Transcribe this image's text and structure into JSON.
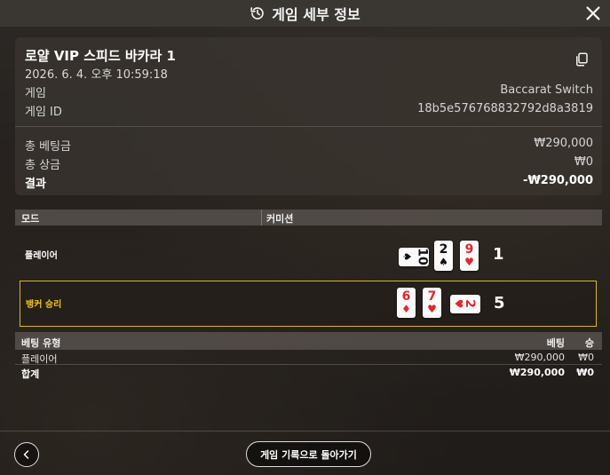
{
  "topbar": {
    "title": "게임 세부 정보",
    "history_icon": "history-icon",
    "close_icon": "close-icon"
  },
  "summary": {
    "game_name": "로얄 VIP 스피드 바카라 1",
    "datetime": "2026. 6. 4. 오후 10:59:18",
    "game_label": "게임",
    "game_value": "Baccarat Switch",
    "game_id_label": "게임 ID",
    "game_id_value": "18b5e576768832792d8a3819",
    "total_bet_label": "총 베팅금",
    "total_bet_value": "₩290,000",
    "total_win_label": "총 상금",
    "total_win_value": "₩0",
    "result_label": "결과",
    "result_value": "-₩290,000",
    "copy_icon": "copy-icon"
  },
  "mode_header": {
    "mode": "모드",
    "commission": "커미션"
  },
  "hands": {
    "player": {
      "label": "플레이어",
      "score": "1",
      "cards": [
        {
          "rank": "10",
          "suit": "♠",
          "color": "black",
          "orientation": "side"
        },
        {
          "rank": "2",
          "suit": "♠",
          "color": "black",
          "orientation": "up"
        },
        {
          "rank": "9",
          "suit": "♥",
          "color": "red",
          "orientation": "up"
        }
      ]
    },
    "banker": {
      "label": "뱅커 승리",
      "score": "5",
      "cards": [
        {
          "rank": "6",
          "suit": "♦",
          "color": "red",
          "orientation": "up"
        },
        {
          "rank": "7",
          "suit": "♥",
          "color": "red",
          "orientation": "up"
        },
        {
          "rank": "2",
          "suit": "♥",
          "color": "red",
          "orientation": "side"
        }
      ]
    }
  },
  "bets": {
    "headers": {
      "type": "베팅 유형",
      "bet": "베팅",
      "win": "승"
    },
    "rows": [
      {
        "type": "플레이어",
        "bet": "₩290,000",
        "win": "₩0"
      }
    ],
    "total": {
      "type": "합계",
      "bet": "₩290,000",
      "win": "₩0"
    }
  },
  "footer": {
    "return_label": "게임 기록으로 돌아가기",
    "back_icon": "chevron-left-icon"
  },
  "colors": {
    "winner_accent": "#f0c419",
    "card_red": "#e5252d"
  }
}
